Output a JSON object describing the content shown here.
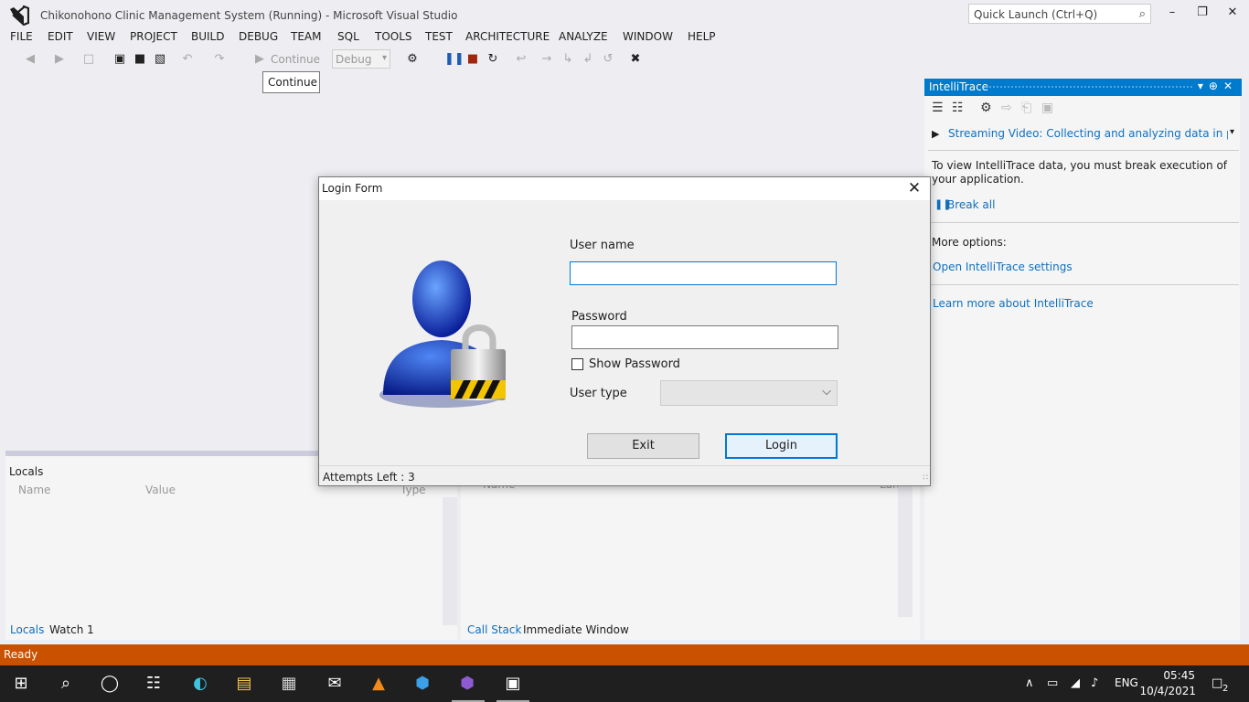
{
  "window": {
    "title": "Chikonohono Clinic Management System (Running) - Microsoft Visual Studio",
    "quick_launch_placeholder": "Quick Launch (Ctrl+Q)"
  },
  "menu": [
    "FILE",
    "EDIT",
    "VIEW",
    "PROJECT",
    "BUILD",
    "DEBUG",
    "TEAM",
    "SQL",
    "TOOLS",
    "TEST",
    "ARCHITECTURE",
    "ANALYZE",
    "WINDOW",
    "HELP"
  ],
  "toolbar": {
    "continue_label": "Continue",
    "config_value": "Debug",
    "tooltip": "Continue"
  },
  "locals": {
    "title": "Locals",
    "columns": [
      "Name",
      "Value",
      "Type"
    ]
  },
  "callstack": {
    "columns": [
      "Name",
      "Lang"
    ]
  },
  "bottom_tabs_left": [
    "Locals",
    "Watch 1"
  ],
  "bottom_tabs_right": [
    "Call Stack",
    "Immediate Window"
  ],
  "intellitrace": {
    "title": "IntelliTrace",
    "video_link": "Streaming Video: Collecting and analyzing data in product",
    "message": "To view IntelliTrace data, you must break execution of your application.",
    "break_all": "Break all",
    "more_options": "More options:",
    "settings_link": "Open IntelliTrace settings",
    "learn_link": "Learn more about IntelliTrace"
  },
  "status": "Ready",
  "login": {
    "title": "Login Form",
    "username_label": "User name",
    "username_value": "",
    "password_label": "Password",
    "password_value": "",
    "show_password_label": "Show Password",
    "show_password_checked": false,
    "user_type_label": "User type",
    "user_type_value": "",
    "exit_label": "Exit",
    "login_label": "Login",
    "attempts": "Attempts Left : 3"
  },
  "taskbar": {
    "language": "ENG",
    "time": "05:45",
    "date": "10/4/2021",
    "notification_count": "2"
  },
  "colors": {
    "accent": "#007acc",
    "status_bar": "#ca5100",
    "link": "#0e70c0",
    "taskbar": "#1f1f1f"
  }
}
